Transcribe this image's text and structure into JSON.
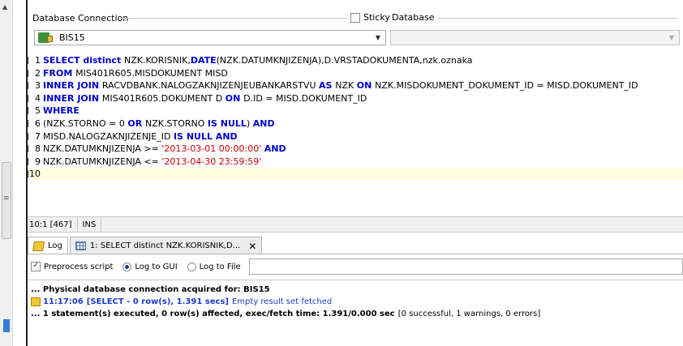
{
  "connection_panel": {
    "legend": "Database Connection",
    "sticky_label": "Sticky",
    "sticky_checked": false,
    "database_legend": "Database",
    "selected_connection": "BIS15",
    "database_value": ""
  },
  "editor": {
    "lines": [
      {
        "num": "1",
        "parts": [
          [
            "kw",
            "SELECT distinct "
          ],
          [
            "txt",
            "NZK.KORISNIK,"
          ],
          [
            "kw",
            "DATE"
          ],
          [
            "txt",
            "(NZK.DATUMKNJIZENJA),D.VRSTADOKUMENTA,nzk.oznaka"
          ]
        ]
      },
      {
        "num": "2",
        "parts": [
          [
            "kw",
            "FROM "
          ],
          [
            "txt",
            "MIS401R605.MISDOKUMENT MISD"
          ]
        ]
      },
      {
        "num": "3",
        "parts": [
          [
            "kw",
            "INNER JOIN "
          ],
          [
            "txt",
            "RACVDBANK.NALOGZAKNJIZENJEUBANKARSTVU "
          ],
          [
            "kw",
            "AS "
          ],
          [
            "txt",
            "NZK "
          ],
          [
            "kw",
            "ON "
          ],
          [
            "txt",
            "NZK.MISDOKUMENT_DOKUMENT_ID = MISD.DOKUMENT_ID"
          ]
        ]
      },
      {
        "num": "4",
        "parts": [
          [
            "kw",
            "INNER JOIN "
          ],
          [
            "txt",
            "MIS401R605.DOKUMENT D "
          ],
          [
            "kw",
            "ON "
          ],
          [
            "txt",
            "D.ID = MISD.DOKUMENT_ID"
          ]
        ]
      },
      {
        "num": "5",
        "parts": [
          [
            "kw",
            "WHERE"
          ]
        ]
      },
      {
        "num": "6",
        "parts": [
          [
            "txt",
            "(NZK.STORNO = 0 "
          ],
          [
            "kw",
            "OR "
          ],
          [
            "txt",
            "NZK.STORNO "
          ],
          [
            "kw",
            "IS NULL"
          ],
          [
            "txt",
            ") "
          ],
          [
            "kw",
            "AND"
          ]
        ]
      },
      {
        "num": "7",
        "parts": [
          [
            "txt",
            "MISD.NALOGZAKNJIZENJE_ID "
          ],
          [
            "kw",
            "IS NULL AND"
          ]
        ]
      },
      {
        "num": "8",
        "parts": [
          [
            "txt",
            "NZK.DATUMKNJIZENJA >= "
          ],
          [
            "str",
            "'2013-03-01 00:00:00' "
          ],
          [
            "kw",
            "AND"
          ]
        ]
      },
      {
        "num": "9",
        "parts": [
          [
            "txt",
            "NZK.DATUMKNJIZENJA <= "
          ],
          [
            "str",
            "'2013-04-30 23:59:59'"
          ]
        ]
      },
      {
        "num": "10",
        "parts": []
      }
    ]
  },
  "status_bar": {
    "position": "10:1 [467]",
    "mode": "INS"
  },
  "tabs": [
    {
      "label": "Log",
      "active": true
    },
    {
      "label": "1: SELECT distinct NZK.KORISNIK,D...",
      "active": false
    }
  ],
  "options": {
    "preprocess_label": "Preprocess script",
    "preprocess_checked": true,
    "log_gui_label": "Log to GUI",
    "log_file_label": "Log to File",
    "log_filename": ""
  },
  "log": {
    "line1": "... Physical database connection acquired for: BIS15",
    "line2_time": "11:17:06",
    "line2_main": "[SELECT - 0 row(s), 1.391 secs]",
    "line2_detail": "Empty result set fetched",
    "line3_main": "... 1 statement(s) executed, 0 row(s) affected, exec/fetch time: 1.391/0.000 sec",
    "line3_detail": "[0 successful, 1 warnings, 0 errors]"
  },
  "colors": {
    "keyword": "#0000cc",
    "string": "#c80000",
    "current_line": "#ffffe0",
    "log_blue": "#1b3ccc"
  }
}
